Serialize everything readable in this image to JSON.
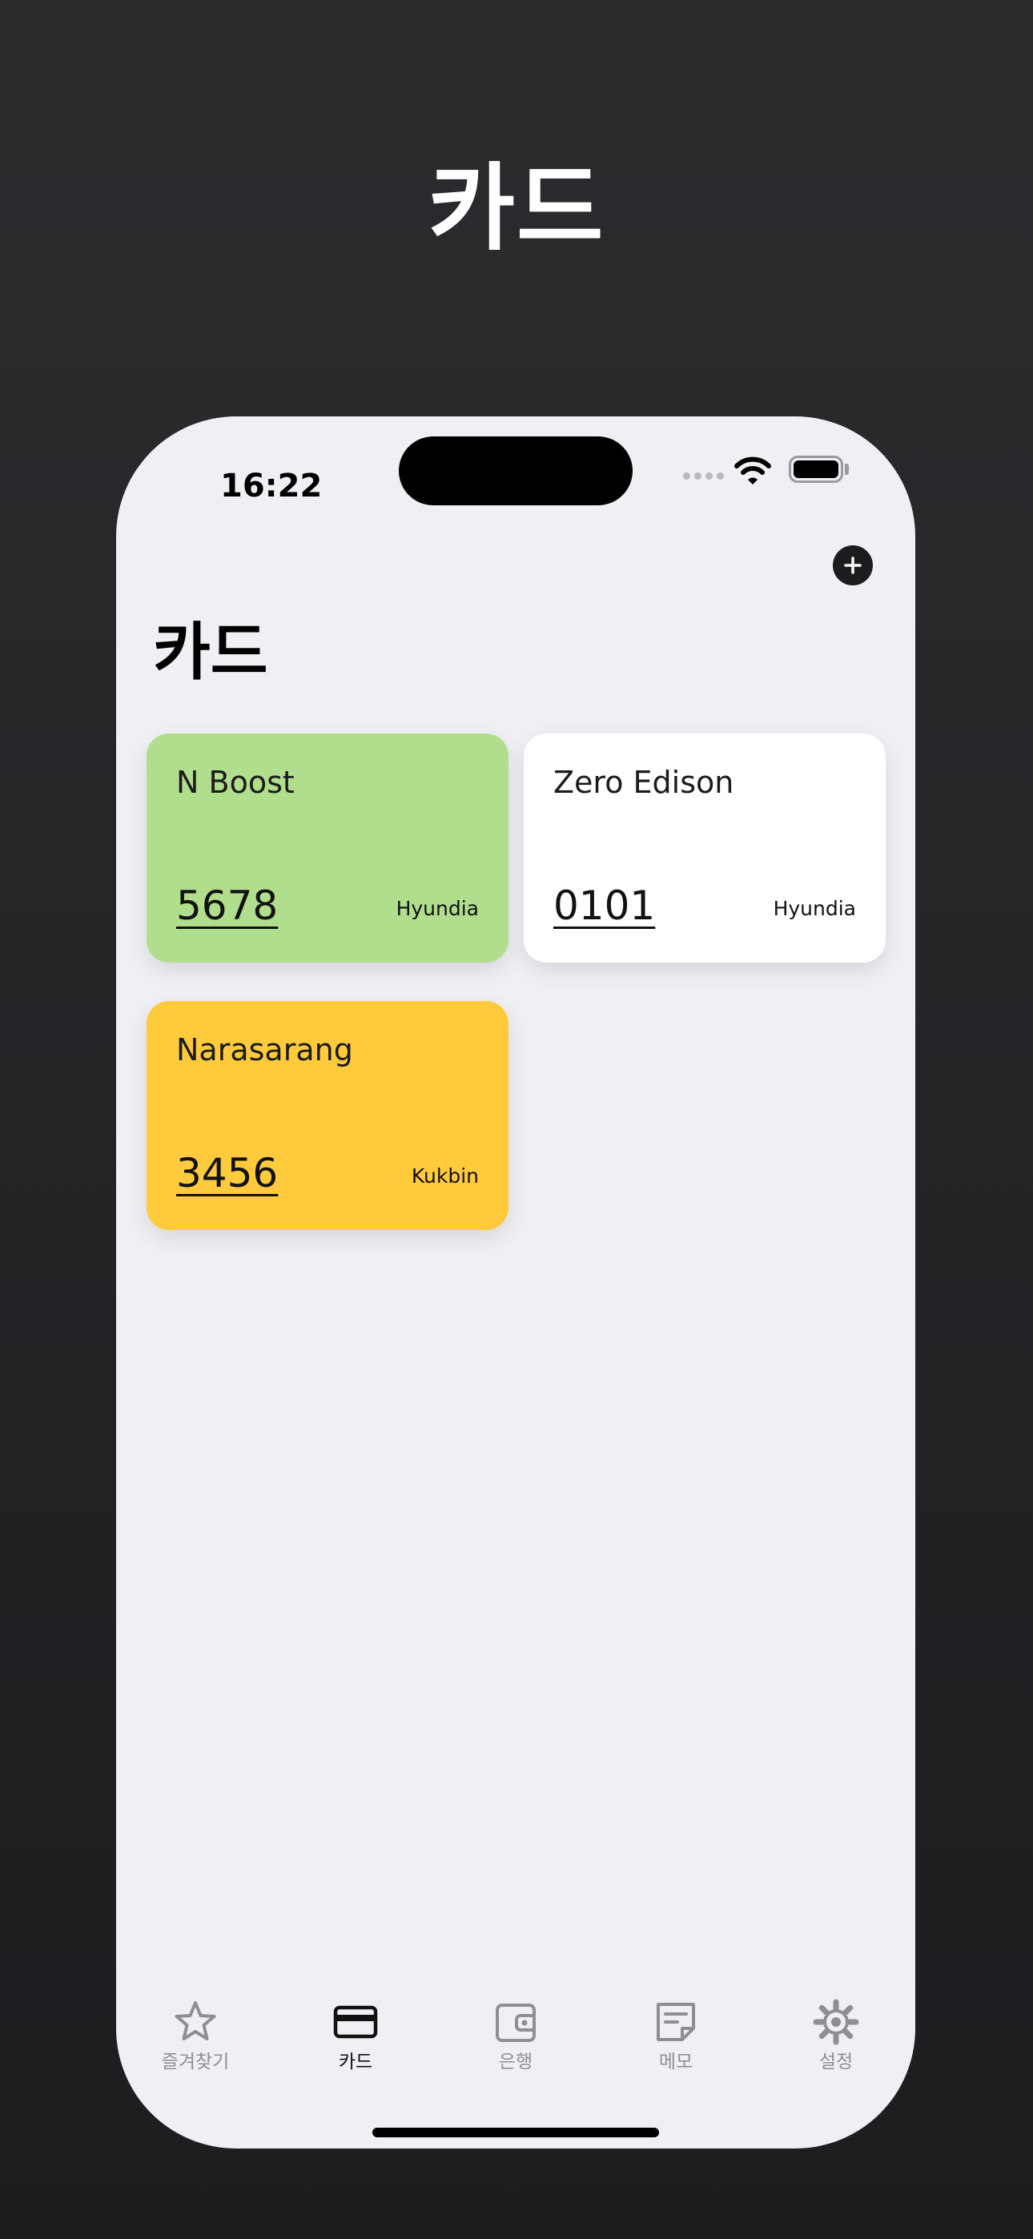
{
  "hero": {
    "title": "카드"
  },
  "status_bar": {
    "time": "16:22"
  },
  "header": {
    "title": "카드"
  },
  "cards": [
    {
      "name": "N Boost",
      "number": "5678",
      "bank": "Hyundia",
      "color": "#b1de8c"
    },
    {
      "name": "Zero Edison",
      "number": "0101",
      "bank": "Hyundia",
      "color": "#ffffff"
    },
    {
      "name": "Narasarang",
      "number": "3456",
      "bank": "Kukbin",
      "color": "#ffcb3d"
    }
  ],
  "tab_bar": {
    "active_index": 1,
    "items": [
      {
        "label": "즐겨찾기",
        "icon": "star-icon"
      },
      {
        "label": "카드",
        "icon": "credit-card-icon"
      },
      {
        "label": "은행",
        "icon": "wallet-icon"
      },
      {
        "label": "메모",
        "icon": "memo-icon"
      },
      {
        "label": "설정",
        "icon": "gear-icon"
      }
    ]
  },
  "colors": {
    "background": "#2a2a2d",
    "screen": "#efeff4",
    "active_tab": "#111111",
    "inactive_tab": "#8e8e93"
  }
}
